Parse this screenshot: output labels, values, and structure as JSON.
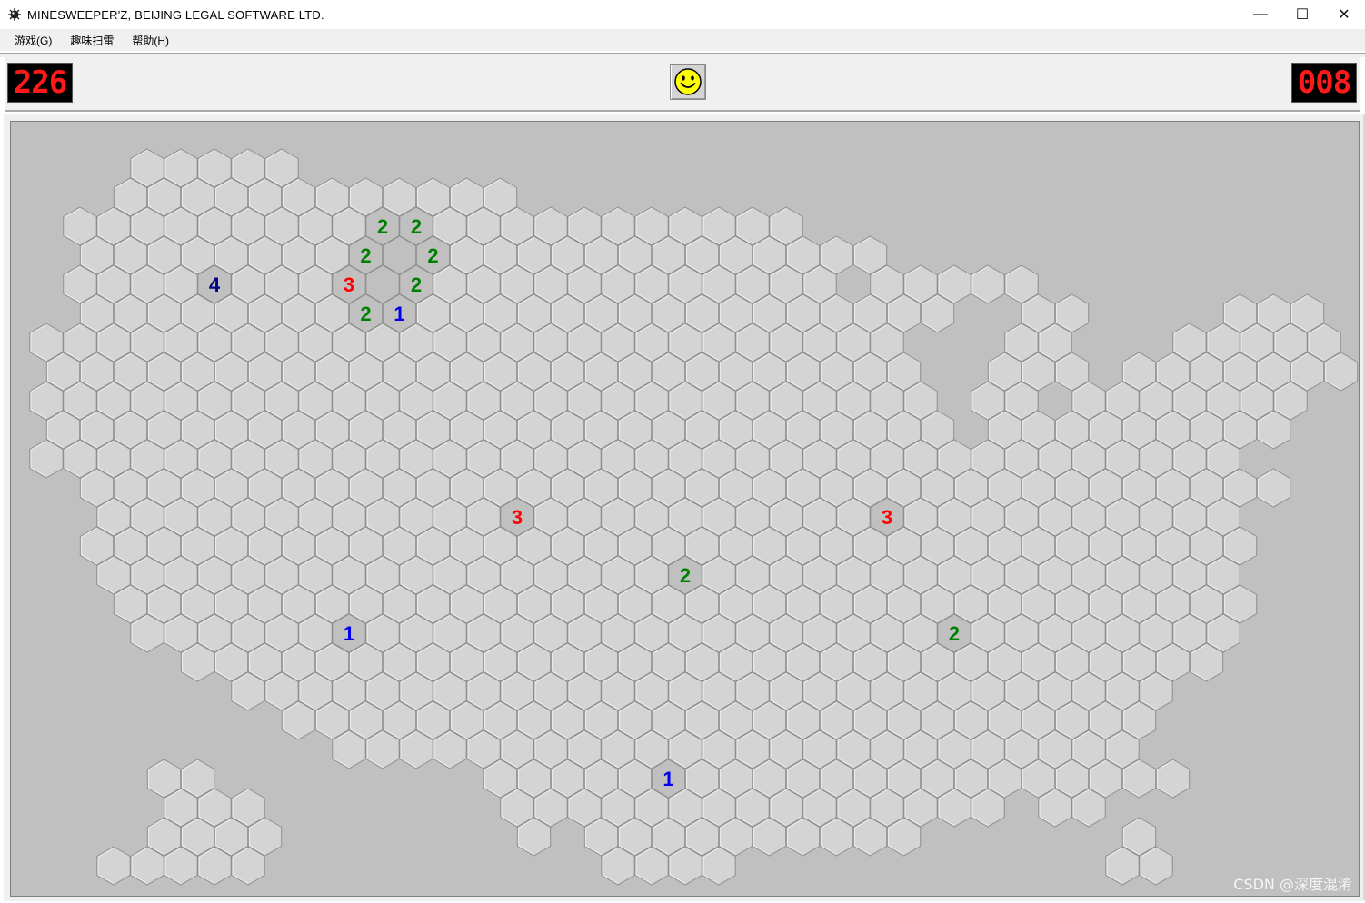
{
  "window": {
    "title": "MINESWEEPER'Z, BEIJING LEGAL SOFTWARE LTD.",
    "minimize": "—",
    "maximize": "☐",
    "close": "✕"
  },
  "menu": {
    "game": "游戏(G)",
    "fun": "趣味扫雷",
    "help": "帮助(H)"
  },
  "counters": {
    "mines_left": "226",
    "time": "008"
  },
  "colors": {
    "board_bg": "#c0c0c0",
    "hex_fill": "#d4d4d4",
    "hex_stroke": "#8e8e8e",
    "revealed_fill": "#c0c0c0",
    "n1": "#0000ee",
    "n2": "#008000",
    "n3": "#ff0000",
    "n4": "#000080"
  },
  "board": {
    "rows": [
      {
        "r": 0,
        "cols": [
          [
            3,
            7
          ]
        ]
      },
      {
        "r": 1,
        "cols": [
          [
            2,
            13
          ]
        ]
      },
      {
        "r": 2,
        "cols": [
          [
            1,
            22
          ]
        ]
      },
      {
        "r": 3,
        "cols": [
          [
            1,
            24
          ]
        ]
      },
      {
        "r": 4,
        "cols": [
          [
            1,
            23
          ],
          [
            25,
            29
          ]
        ]
      },
      {
        "r": 5,
        "cols": [
          [
            1,
            26
          ],
          [
            29,
            30
          ],
          [
            35,
            37
          ]
        ]
      },
      {
        "r": 6,
        "cols": [
          [
            0,
            25
          ],
          [
            29,
            30
          ],
          [
            34,
            38
          ]
        ]
      },
      {
        "r": 7,
        "cols": [
          [
            0,
            25
          ],
          [
            28,
            30
          ],
          [
            32,
            38
          ]
        ]
      },
      {
        "r": 8,
        "cols": [
          [
            0,
            26
          ],
          [
            28,
            29
          ],
          [
            31,
            37
          ]
        ]
      },
      {
        "r": 9,
        "cols": [
          [
            0,
            26
          ],
          [
            28,
            36
          ]
        ]
      },
      {
        "r": 10,
        "cols": [
          [
            0,
            35
          ]
        ]
      },
      {
        "r": 11,
        "cols": [
          [
            1,
            36
          ]
        ]
      },
      {
        "r": 12,
        "cols": [
          [
            2,
            35
          ]
        ]
      },
      {
        "r": 13,
        "cols": [
          [
            1,
            35
          ]
        ]
      },
      {
        "r": 14,
        "cols": [
          [
            2,
            35
          ]
        ]
      },
      {
        "r": 15,
        "cols": [
          [
            2,
            35
          ]
        ]
      },
      {
        "r": 16,
        "cols": [
          [
            3,
            35
          ]
        ]
      },
      {
        "r": 17,
        "cols": [
          [
            4,
            34
          ]
        ]
      },
      {
        "r": 18,
        "cols": [
          [
            6,
            33
          ]
        ]
      },
      {
        "r": 19,
        "cols": [
          [
            7,
            32
          ]
        ]
      },
      {
        "r": 20,
        "cols": [
          [
            9,
            32
          ]
        ]
      },
      {
        "r": 21,
        "cols": [
          [
            13,
            33
          ]
        ]
      },
      {
        "r": 22,
        "cols": [
          [
            14,
            28
          ],
          [
            30,
            31
          ]
        ]
      },
      {
        "r": 23,
        "cols": [
          [
            14,
            14
          ],
          [
            16,
            25
          ],
          [
            32,
            32
          ]
        ]
      },
      {
        "r": 24,
        "cols": [
          [
            17,
            20
          ],
          [
            32,
            33
          ]
        ]
      }
    ],
    "extra": [
      {
        "r": 21,
        "c": 3
      },
      {
        "r": 21,
        "c": 4
      },
      {
        "r": 22,
        "c": 4
      },
      {
        "r": 22,
        "c": 5
      },
      {
        "r": 22,
        "c": 6
      },
      {
        "r": 23,
        "c": 3
      },
      {
        "r": 23,
        "c": 4
      },
      {
        "r": 23,
        "c": 5
      },
      {
        "r": 23,
        "c": 6
      },
      {
        "r": 24,
        "c": 2
      },
      {
        "r": 24,
        "c": 3
      },
      {
        "r": 24,
        "c": 4
      },
      {
        "r": 24,
        "c": 5
      },
      {
        "r": 24,
        "c": 6
      }
    ],
    "revealed": [
      {
        "r": 2,
        "c": 10,
        "n": "2"
      },
      {
        "r": 2,
        "c": 11,
        "n": "2"
      },
      {
        "r": 3,
        "c": 9,
        "n": "2"
      },
      {
        "r": 3,
        "c": 10,
        "n": ""
      },
      {
        "r": 3,
        "c": 11,
        "n": "2"
      },
      {
        "r": 4,
        "c": 9,
        "n": "3"
      },
      {
        "r": 4,
        "c": 10,
        "n": ""
      },
      {
        "r": 4,
        "c": 11,
        "n": "2"
      },
      {
        "r": 5,
        "c": 9,
        "n": "2"
      },
      {
        "r": 5,
        "c": 10,
        "n": "1"
      },
      {
        "r": 4,
        "c": 5,
        "n": "4"
      },
      {
        "r": 12,
        "c": 14,
        "n": "3"
      },
      {
        "r": 12,
        "c": 25,
        "n": "3"
      },
      {
        "r": 14,
        "c": 19,
        "n": "2"
      },
      {
        "r": 16,
        "c": 9,
        "n": "1"
      },
      {
        "r": 16,
        "c": 27,
        "n": "2"
      },
      {
        "r": 21,
        "c": 18,
        "n": "1"
      }
    ]
  },
  "watermark": "CSDN @深度混淆"
}
